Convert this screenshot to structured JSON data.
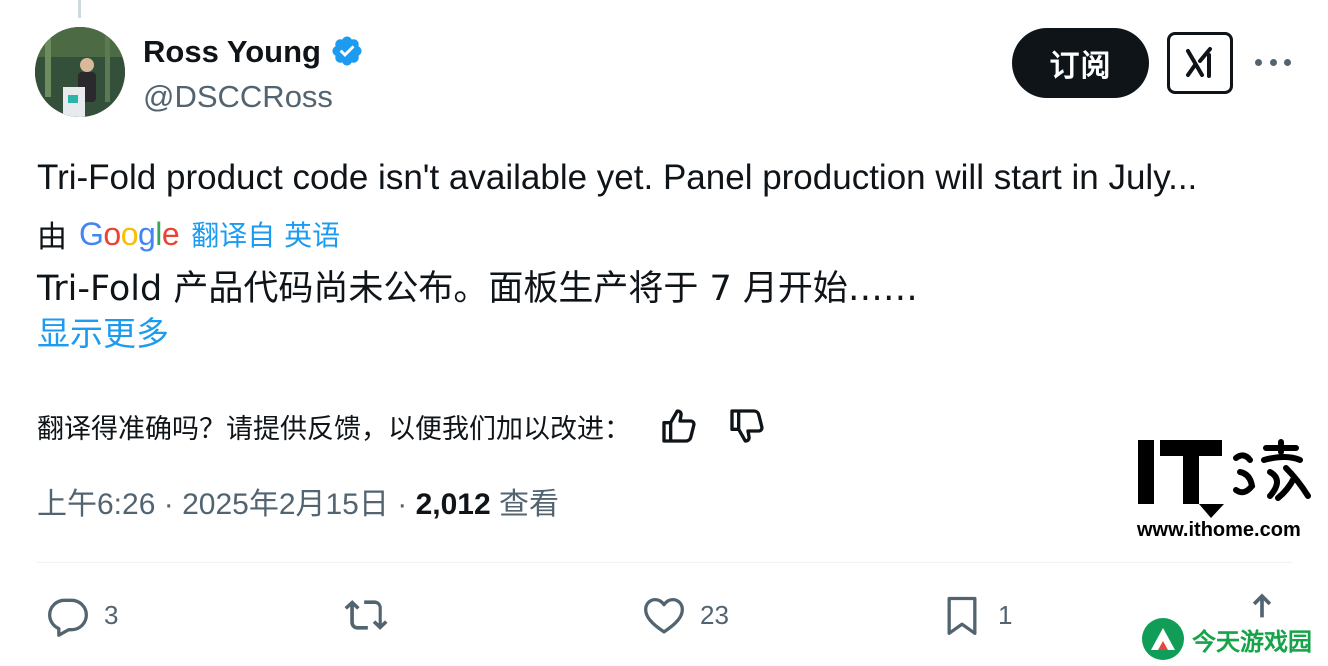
{
  "author": {
    "name": "Ross Young",
    "handle": "@DSCCRoss"
  },
  "header": {
    "subscribe_label": "订阅"
  },
  "tweet": {
    "text": "Tri-Fold product code isn't available yet. Panel production will start in July...",
    "translated_by_prefix": "由",
    "translator_logo": [
      "G",
      "o",
      "o",
      "g",
      "l",
      "e"
    ],
    "translate_link": "翻译自 英语",
    "translated_text": "Tri-Fold 产品代码尚未公布。面板生产将于 7 月开始……",
    "show_more": "显示更多",
    "feedback_prompt": "翻译得准确吗？请提供反馈，以便我们加以改进："
  },
  "meta": {
    "time": "上午6:26",
    "separator": "·",
    "date": "2025年2月15日",
    "views_count": "2,012",
    "views_label": "查看"
  },
  "actions": {
    "replies": "3",
    "likes": "23",
    "bookmarks": "1"
  },
  "watermarks": {
    "site": "www.ithome.com",
    "game_site": "今天游戏园"
  },
  "colors": {
    "text": "#0f1419",
    "muted": "#536471",
    "link": "#1d9bf0",
    "verified": "#1d9bf0",
    "divider": "#eff3f4"
  },
  "icons": {
    "verified": "verified-badge-icon",
    "grok": "grok-icon",
    "more": "more-icon",
    "thumbs_up": "thumbs-up-icon",
    "thumbs_down": "thumbs-down-icon",
    "reply": "reply-icon",
    "retweet": "retweet-icon",
    "like": "heart-icon",
    "bookmark": "bookmark-icon",
    "share": "share-icon"
  }
}
